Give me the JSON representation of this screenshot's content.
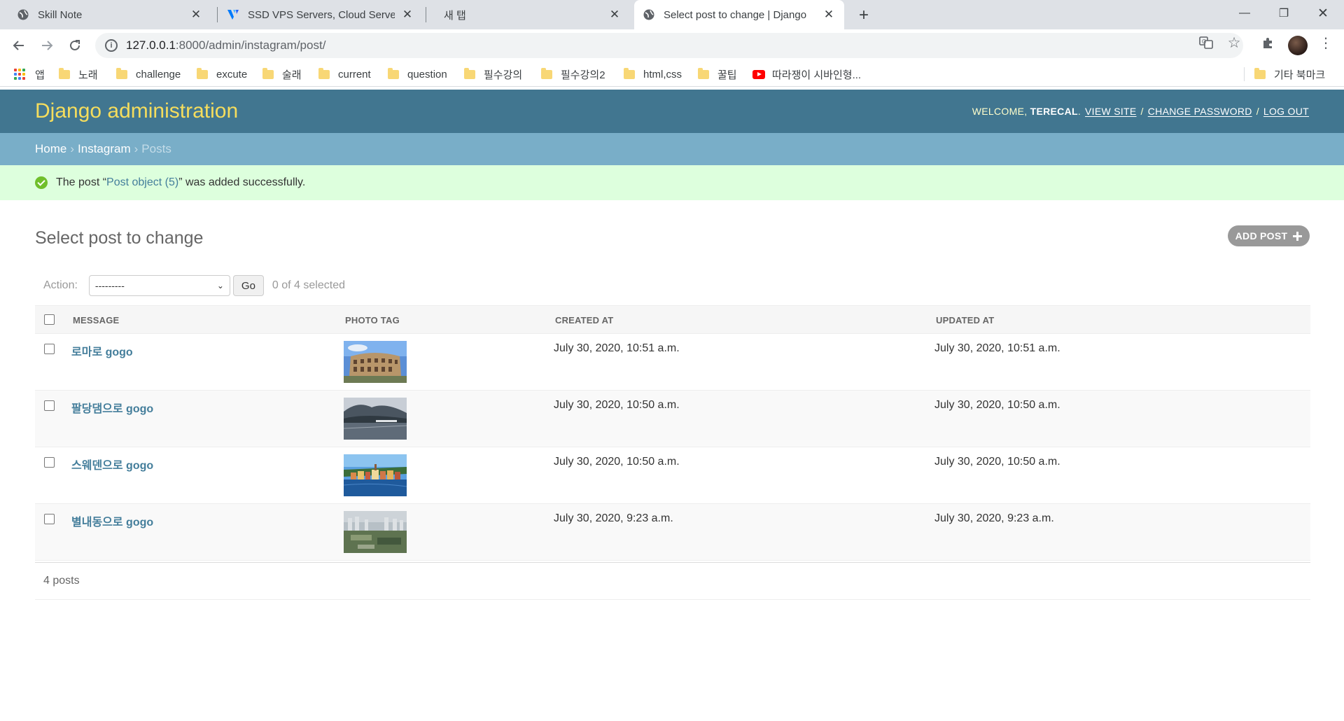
{
  "browser": {
    "tabs": [
      {
        "title": "Skill Note"
      },
      {
        "title": "SSD VPS Servers, Cloud Servers"
      },
      {
        "title": "새 탭"
      },
      {
        "title": "Select post to change | Django"
      }
    ],
    "url_host": "127.0.0.1",
    "url_rest": ":8000/admin/instagram/post/",
    "bookmarks": [
      "앱",
      "노래",
      "challenge",
      "excute",
      "술래",
      "current",
      "question",
      "필수강의",
      "필수강의2",
      "html,css",
      "꿀팁",
      "따라쟁이 시바인형...",
      "기타 북마크"
    ]
  },
  "admin": {
    "branding": "Django administration",
    "usertools": {
      "welcome": "WELCOME,",
      "username": "TERECAL",
      "view_site": "VIEW SITE",
      "change_password": "CHANGE PASSWORD",
      "log_out": "LOG OUT",
      "sep": "/"
    },
    "breadcrumbs": {
      "home": "Home",
      "app": "Instagram",
      "current": "Posts",
      "sep": "›"
    },
    "message": {
      "prefix": "The post “",
      "link": "Post object (5)",
      "suffix": "” was added successfully."
    },
    "title": "Select post to change",
    "add_button": "ADD POST",
    "actions": {
      "label": "Action:",
      "selected": "---------",
      "go": "Go",
      "counter": "0 of 4 selected"
    },
    "columns": {
      "message": "MESSAGE",
      "photo_tag": "PHOTO TAG",
      "created_at": "CREATED AT",
      "updated_at": "UPDATED AT"
    },
    "rows": [
      {
        "message": "로마로 gogo",
        "created": "July 30, 2020, 10:51 a.m.",
        "updated": "July 30, 2020, 10:51 a.m."
      },
      {
        "message": "팔당댐으로 gogo",
        "created": "July 30, 2020, 10:50 a.m.",
        "updated": "July 30, 2020, 10:50 a.m."
      },
      {
        "message": "스웨덴으로 gogo",
        "created": "July 30, 2020, 10:50 a.m.",
        "updated": "July 30, 2020, 10:50 a.m."
      },
      {
        "message": "별내동으로 gogo",
        "created": "July 30, 2020, 9:23 a.m.",
        "updated": "July 30, 2020, 9:23 a.m."
      }
    ],
    "paginator": "4 posts"
  },
  "colors": {
    "header": "#417690",
    "branding": "#f5dd5d",
    "breadcrumbs": "#79aec8",
    "success": "#dfd",
    "link": "#447e9b"
  }
}
